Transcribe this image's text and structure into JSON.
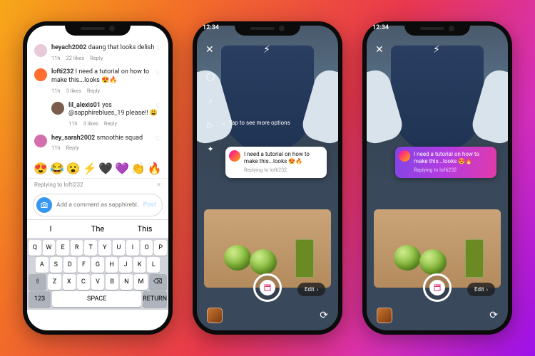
{
  "status_time": "12:34",
  "comments": [
    {
      "user": "heyach2002",
      "text": "daang that looks delish",
      "time": "11h",
      "likes": "22 likes",
      "avatar": "#e8c9d8"
    },
    {
      "user": "lofti232",
      "text": "I need a tutorial on how to make this...looks 😍🔥",
      "time": "11h",
      "likes": "3 likes",
      "avatar": "#ff6d2f"
    },
    {
      "user": "lil_alexis01",
      "text": "yes @sapphireblues_19 please!! 😩",
      "time": "11h",
      "likes": "3 likes",
      "avatar": "#7a5c4a",
      "indent": true
    },
    {
      "user": "hey_sarah2002",
      "text": "smoothie squad",
      "time": "11h",
      "likes": "",
      "avatar": "#d46fae"
    }
  ],
  "reply_label": "Reply",
  "replying_to": "Replying to lofti232",
  "emoji_row": [
    "😍",
    "😂",
    "😮",
    "⚡",
    "🖤",
    "💜",
    "👏",
    "🔥"
  ],
  "input_placeholder": "Add a comment as sapphirebl...",
  "post_label": "Post",
  "quicktype": [
    "I",
    "The",
    "This"
  ],
  "kb_rows": [
    [
      "q",
      "w",
      "e",
      "r",
      "t",
      "y",
      "u",
      "i",
      "o",
      "p"
    ],
    [
      "a",
      "s",
      "d",
      "f",
      "g",
      "h",
      "j",
      "k",
      "l"
    ],
    [
      "⇧",
      "z",
      "x",
      "c",
      "v",
      "b",
      "n",
      "m",
      "⌫"
    ]
  ],
  "kb_space": [
    "123",
    "space",
    "return"
  ],
  "reel": {
    "more_options": "Tap to see more options",
    "sticker_text": "I need a tutorial on how to make this...looks 😍🔥",
    "sticker_sub": "Replying to lofti232",
    "edit": "Edit"
  }
}
